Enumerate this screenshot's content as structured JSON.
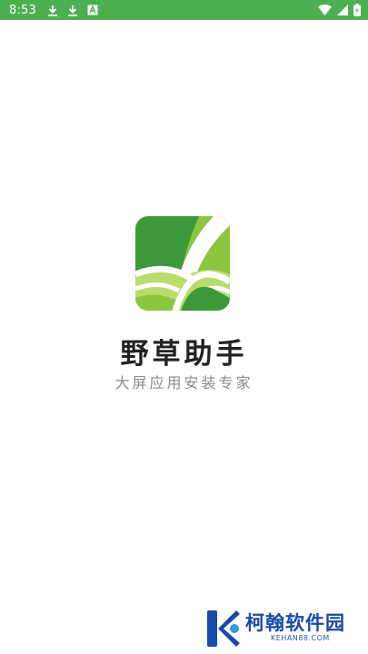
{
  "status_bar": {
    "time": "8:53",
    "left_icons": [
      "download-icon",
      "download-icon",
      "notification-a-icon"
    ],
    "right_icons": [
      "wifi-icon",
      "signal-icon",
      "battery-charging-icon"
    ],
    "background": "#4caf50"
  },
  "splash": {
    "app_name": "野草助手",
    "tagline": "大屏应用安装专家",
    "logo_colors": {
      "dark_green": "#3d9a3a",
      "light_green": "#8cc63e",
      "pale_green": "#b9dc6c"
    }
  },
  "watermark": {
    "title": "柯翰软件园",
    "subtitle": "KEHAN88.COM",
    "color": "#1a4aa8"
  }
}
